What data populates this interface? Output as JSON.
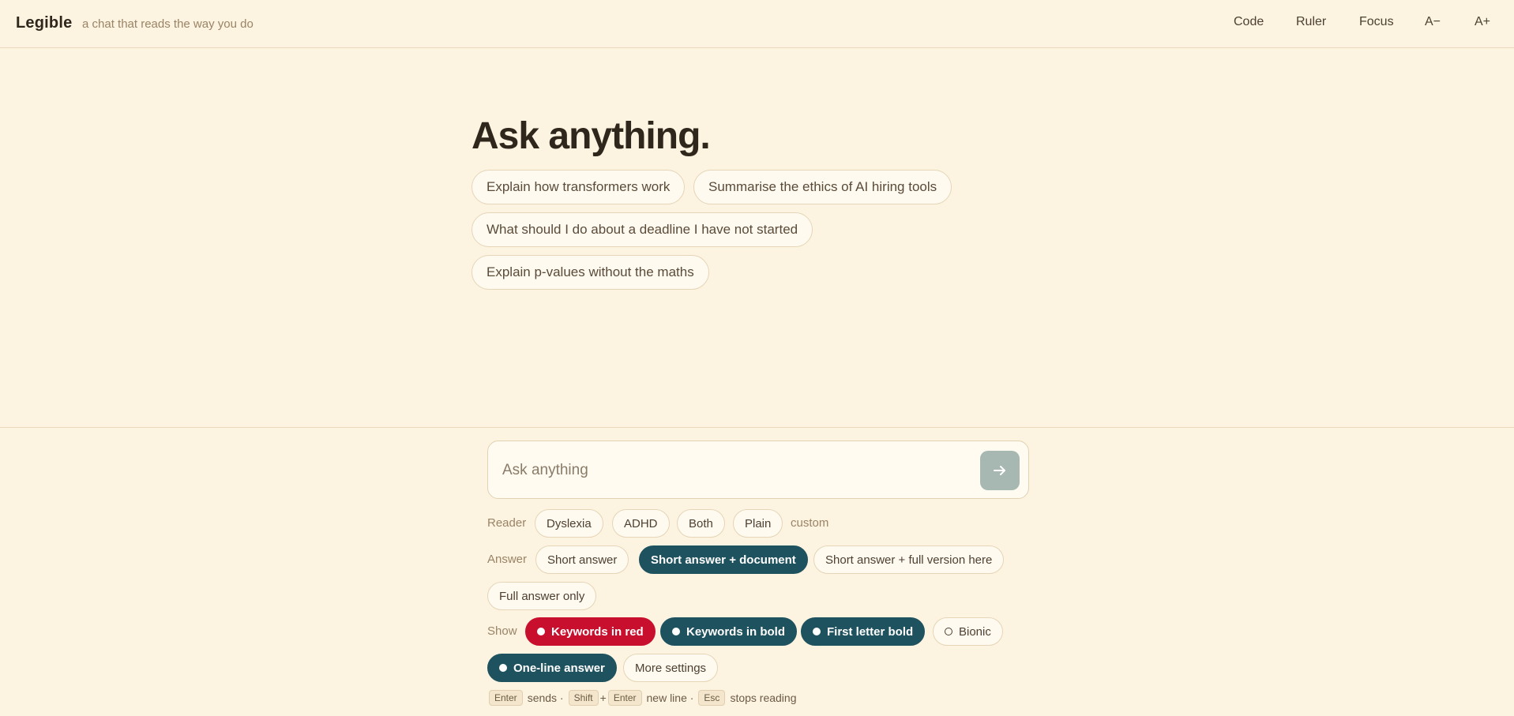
{
  "header": {
    "brand": "Legible",
    "tagline": "a chat that reads the way you do",
    "nav": [
      "Code",
      "Ruler",
      "Focus",
      "A−",
      "A+"
    ]
  },
  "hero": {
    "title": "Ask anything.",
    "suggestions": [
      "Explain how transformers work",
      "Summarise the ethics of AI hiring tools",
      "What should I do about a deadline I have not started",
      "Explain p-values without the maths"
    ]
  },
  "composer": {
    "placeholder": "Ask anything",
    "send_icon": "arrow-right-icon"
  },
  "reader": {
    "label": "Reader",
    "options": [
      "Dyslexia",
      "ADHD",
      "Both",
      "Plain"
    ],
    "custom": "custom"
  },
  "answer": {
    "label": "Answer",
    "options": [
      "Short answer",
      "Short answer + document",
      "Short answer + full version here",
      "Full answer only"
    ],
    "selected": "Short answer + document"
  },
  "show": {
    "label": "Show",
    "options": [
      "Keywords in red",
      "Keywords in bold",
      "First letter bold",
      "Bionic",
      "One-line answer"
    ],
    "more": "More settings"
  },
  "hint": {
    "enter": "Enter",
    "sends": "sends ·",
    "shift": "Shift",
    "plus": "+",
    "enter2": "Enter",
    "newline": "new line ·",
    "esc": "Esc",
    "stops": "stops reading"
  },
  "colors": {
    "background": "#fcf3e1",
    "active": "#1f525f",
    "red": "#c8102e",
    "send": "#a7b8b2"
  }
}
